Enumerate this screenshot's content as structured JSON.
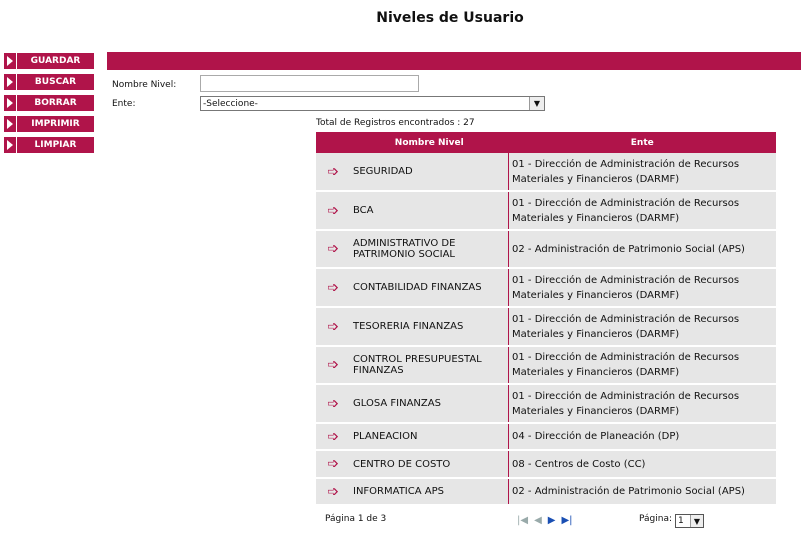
{
  "page": {
    "title": "Niveles de Usuario"
  },
  "actions": [
    {
      "label": "GUARDAR"
    },
    {
      "label": "BUSCAR"
    },
    {
      "label": "BORRAR"
    },
    {
      "label": "IMPRIMIR"
    },
    {
      "label": "LIMPIAR"
    }
  ],
  "form": {
    "nombre_label": "Nombre Nivel:",
    "nombre_value": "",
    "ente_label": "Ente:",
    "ente_selected": "-Seleccione-"
  },
  "results": {
    "total_text": "Total de Registros encontrados : 27"
  },
  "table": {
    "headers": {
      "nombre": "Nombre Nivel",
      "ente": "Ente"
    },
    "rows": [
      {
        "nombre": "SEGURIDAD",
        "ente": "01 - Dirección de Administración de Recursos Materiales y Financieros (DARMF)"
      },
      {
        "nombre": "BCA",
        "ente": "01 - Dirección de Administración de Recursos Materiales y Financieros (DARMF)"
      },
      {
        "nombre": "ADMINISTRATIVO DE PATRIMONIO SOCIAL",
        "ente": "02 - Administración de Patrimonio Social (APS)"
      },
      {
        "nombre": "CONTABILIDAD FINANZAS",
        "ente": "01 - Dirección de Administración de Recursos Materiales y Financieros (DARMF)"
      },
      {
        "nombre": "TESORERIA FINANZAS",
        "ente": "01 - Dirección de Administración de Recursos Materiales y Financieros (DARMF)"
      },
      {
        "nombre": "CONTROL PRESUPUESTAL FINANZAS",
        "ente": "01 - Dirección de Administración de Recursos Materiales y Financieros (DARMF)"
      },
      {
        "nombre": "GLOSA FINANZAS",
        "ente": "01 - Dirección de Administración de Recursos Materiales y Financieros (DARMF)"
      },
      {
        "nombre": "PLANEACION",
        "ente": "04 - Dirección de Planeación (DP)"
      },
      {
        "nombre": "CENTRO DE COSTO",
        "ente": "08 - Centros de Costo (CC)"
      },
      {
        "nombre": "INFORMATICA APS",
        "ente": "02 - Administración de Patrimonio Social (APS)"
      }
    ]
  },
  "pager": {
    "page_text": "Página 1 de 3",
    "page_label": "Página:",
    "page_selected": "1"
  },
  "colors": {
    "accent": "#b0144a",
    "row_bg": "#e6e6e6",
    "pager_enabled": "#1a4fb3"
  },
  "icons": {
    "row_action": "arrow-right-icon",
    "first": "first-page-icon",
    "prev": "prev-page-icon",
    "next": "next-page-icon",
    "last": "last-page-icon"
  }
}
